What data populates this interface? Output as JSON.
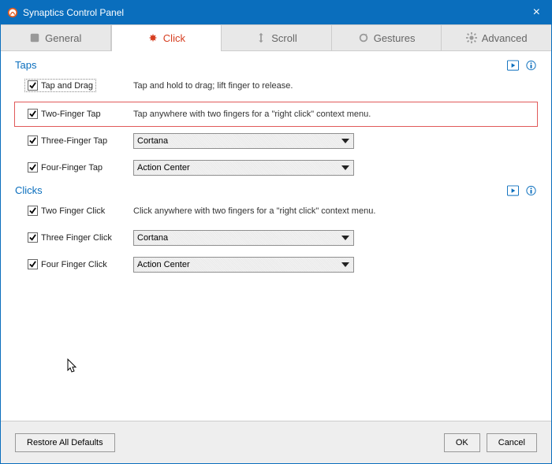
{
  "window": {
    "title": "Synaptics Control Panel"
  },
  "tabs": {
    "general": "General",
    "click": "Click",
    "scroll": "Scroll",
    "gestures": "Gestures",
    "advanced": "Advanced",
    "active_index": 1
  },
  "sections": {
    "taps": {
      "title": "Taps",
      "items": [
        {
          "label": "Tap and Drag",
          "checked": true,
          "desc": "Tap and hold to drag; lift finger to release."
        },
        {
          "label": "Two-Finger Tap",
          "checked": true,
          "desc": "Tap anywhere with two fingers for a \"right click\" context menu.",
          "highlight": true
        },
        {
          "label": "Three-Finger Tap",
          "checked": true,
          "select": "Cortana"
        },
        {
          "label": "Four-Finger Tap",
          "checked": true,
          "select": "Action Center"
        }
      ]
    },
    "clicks": {
      "title": "Clicks",
      "items": [
        {
          "label": "Two Finger Click",
          "checked": true,
          "desc": "Click anywhere with two fingers for a \"right click\" context menu."
        },
        {
          "label": "Three Finger Click",
          "checked": true,
          "select": "Cortana"
        },
        {
          "label": "Four Finger Click",
          "checked": true,
          "select": "Action Center"
        }
      ]
    }
  },
  "buttons": {
    "restore": "Restore All Defaults",
    "ok": "OK",
    "cancel": "Cancel"
  }
}
